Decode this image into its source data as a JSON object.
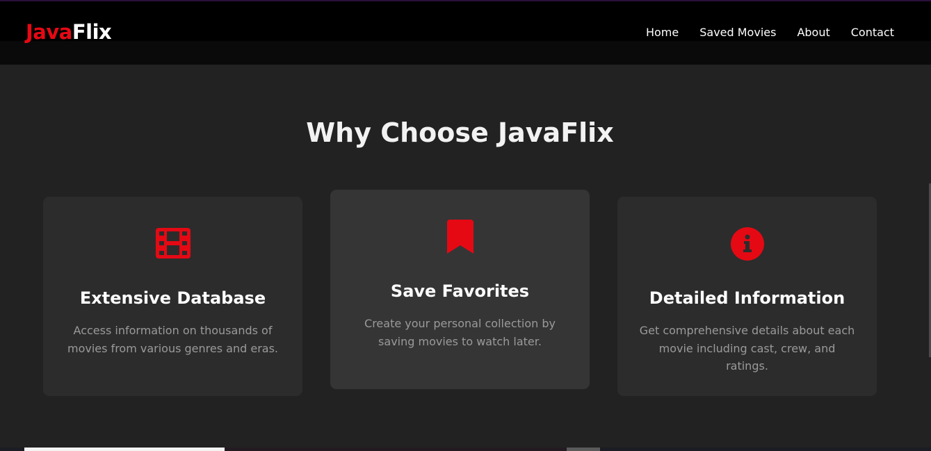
{
  "header": {
    "logo_part1": "Java",
    "logo_part2": "Flix",
    "nav": [
      {
        "label": "Home"
      },
      {
        "label": "Saved Movies"
      },
      {
        "label": "About"
      },
      {
        "label": "Contact"
      }
    ]
  },
  "features": {
    "title": "Why Choose JavaFlix",
    "cards": [
      {
        "icon": "film-icon",
        "title": "Extensive Database",
        "text": "Access information on thousands of movies from various genres and eras."
      },
      {
        "icon": "bookmark-icon",
        "title": "Save Favorites",
        "text": "Create your personal collection by saving movies to watch later."
      },
      {
        "icon": "info-circle-icon",
        "title": "Detailed Information",
        "text": "Get comprehensive details about each movie including cast, crew, and ratings."
      }
    ]
  },
  "colors": {
    "accent": "#e50914",
    "background": "#222222",
    "card": "#2c2c2c",
    "card_hover": "#353535",
    "navbar": "#000000"
  }
}
